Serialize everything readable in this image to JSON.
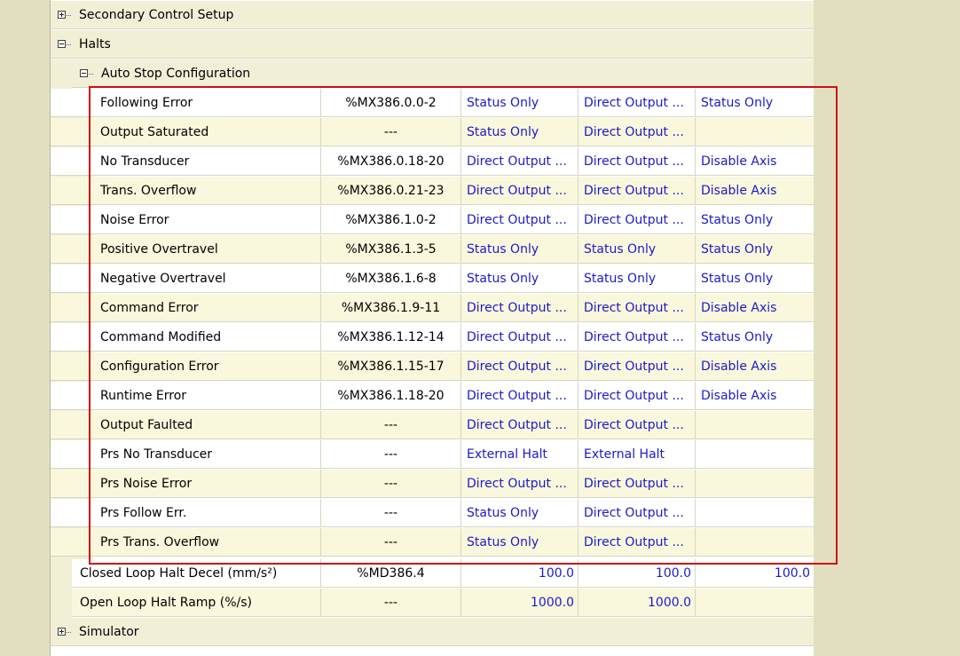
{
  "sections": {
    "secondary": "Secondary Control Setup",
    "halts": "Halts",
    "auto_stop": "Auto Stop Configuration",
    "simulator": "Simulator"
  },
  "rows": [
    {
      "name": "Following Error",
      "addr": "%MX386.0.0-2",
      "v1": "Status Only",
      "v2": "Direct Output ...",
      "v3": "Status Only"
    },
    {
      "name": "Output Saturated",
      "addr": "---",
      "v1": "Status Only",
      "v2": "Direct Output ...",
      "v3": ""
    },
    {
      "name": "No Transducer",
      "addr": "%MX386.0.18-20",
      "v1": "Direct Output ...",
      "v2": "Direct Output ...",
      "v3": "Disable Axis"
    },
    {
      "name": "Trans. Overflow",
      "addr": "%MX386.0.21-23",
      "v1": "Direct Output ...",
      "v2": "Direct Output ...",
      "v3": "Disable Axis"
    },
    {
      "name": "Noise Error",
      "addr": "%MX386.1.0-2",
      "v1": "Direct Output ...",
      "v2": "Direct Output ...",
      "v3": "Status Only"
    },
    {
      "name": "Positive Overtravel",
      "addr": "%MX386.1.3-5",
      "v1": "Status Only",
      "v2": "Status Only",
      "v3": "Status Only"
    },
    {
      "name": "Negative Overtravel",
      "addr": "%MX386.1.6-8",
      "v1": "Status Only",
      "v2": "Status Only",
      "v3": "Status Only"
    },
    {
      "name": "Command Error",
      "addr": "%MX386.1.9-11",
      "v1": "Direct Output ...",
      "v2": "Direct Output ...",
      "v3": "Disable Axis"
    },
    {
      "name": "Command Modified",
      "addr": "%MX386.1.12-14",
      "v1": "Direct Output ...",
      "v2": "Direct Output ...",
      "v3": "Status Only"
    },
    {
      "name": "Configuration Error",
      "addr": "%MX386.1.15-17",
      "v1": "Direct Output ...",
      "v2": "Direct Output ...",
      "v3": "Disable Axis"
    },
    {
      "name": "Runtime Error",
      "addr": "%MX386.1.18-20",
      "v1": "Direct Output ...",
      "v2": "Direct Output ...",
      "v3": "Disable Axis"
    },
    {
      "name": "Output Faulted",
      "addr": "---",
      "v1": "Direct Output ...",
      "v2": "Direct Output ...",
      "v3": ""
    },
    {
      "name": "Prs No Transducer",
      "addr": "---",
      "v1": "External Halt",
      "v2": "External Halt",
      "v3": ""
    },
    {
      "name": "Prs Noise Error",
      "addr": "---",
      "v1": "Direct Output ...",
      "v2": "Direct Output ...",
      "v3": ""
    },
    {
      "name": "Prs Follow Err.",
      "addr": "---",
      "v1": "Status Only",
      "v2": "Direct Output ...",
      "v3": ""
    },
    {
      "name": "Prs Trans. Overflow",
      "addr": "---",
      "v1": "Status Only",
      "v2": "Direct Output ...",
      "v3": ""
    }
  ],
  "halt_rows": [
    {
      "name": "Closed Loop Halt Decel (mm/s²)",
      "addr": "%MD386.4",
      "v1": "100.0",
      "v2": "100.0",
      "v3": "100.0"
    },
    {
      "name": "Open Loop Halt Ramp (%/s)",
      "addr": "---",
      "v1": "1000.0",
      "v2": "1000.0",
      "v3": ""
    }
  ],
  "colors": {
    "value_text": "#1a1acc",
    "highlight": "#cc1111",
    "alt_row": "#f9f8dc",
    "background": "#e2dfc1"
  }
}
